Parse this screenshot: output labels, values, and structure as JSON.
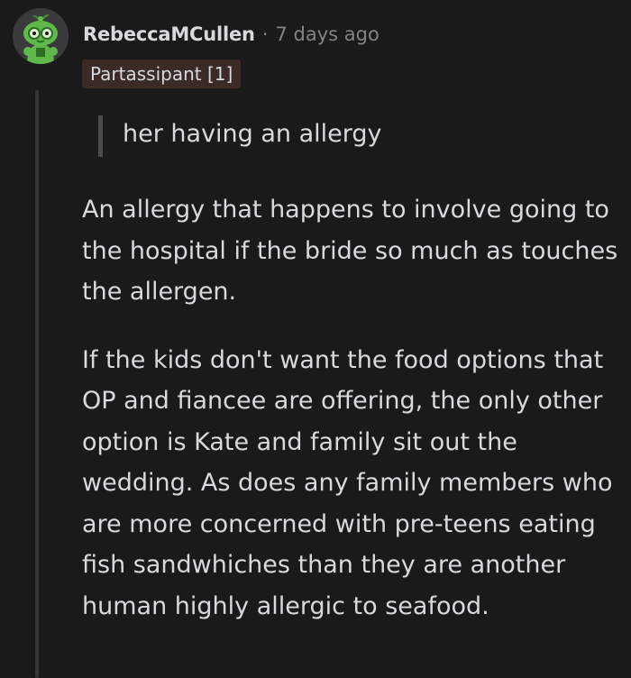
{
  "comment": {
    "author": "RebeccaMCullen",
    "separator": "·",
    "timestamp": "7 days ago",
    "flair": "Partassipant [1]",
    "quote": "her having an allergy",
    "paragraphs": [
      "An allergy that happens to involve going to the hospital if the bride so much as touches the allergen.",
      "If the kids don't want the food options that OP and fiancee are offering, the only other option is Kate and family sit out the wedding. As does any family members who are more concerned with pre-teens eating fish sandwhiches than they are another human highly allergic to seafood."
    ]
  },
  "colors": {
    "background": "#1a1a1b",
    "text": "#d7dadc",
    "meta": "#818384",
    "flair_bg": "#3a2b27",
    "avatar_green": "#5fb84a"
  },
  "icons": {
    "avatar": "snoo-avatar-green-glasses"
  }
}
